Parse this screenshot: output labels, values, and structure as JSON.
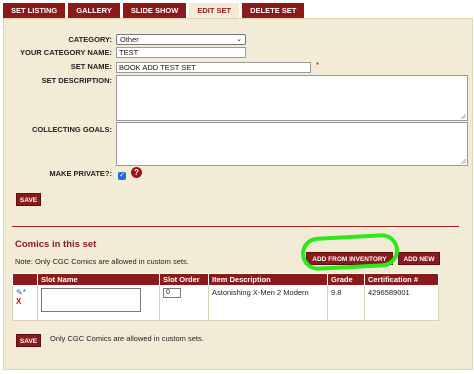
{
  "tabs": [
    {
      "label": "SET LISTING",
      "active": false
    },
    {
      "label": "GALLERY",
      "active": false
    },
    {
      "label": "SLIDE SHOW",
      "active": false
    },
    {
      "label": "EDIT SET",
      "active": true
    },
    {
      "label": "DELETE SET",
      "active": false
    }
  ],
  "form": {
    "category_label": "CATEGORY:",
    "category_value": "Other",
    "your_category_label": "YOUR CATEGORY NAME:",
    "your_category_value": "TEST",
    "set_name_label": "SET NAME:",
    "set_name_value": "BOOK ADD TEST SET",
    "required_mark": "*",
    "set_description_label": "SET DESCRIPTION:",
    "collecting_goals_label": "COLLECTING GOALS:",
    "make_private_label": "MAKE PRIVATE?:",
    "make_private_checked": true,
    "help_glyph": "?",
    "save_label": "SAVE"
  },
  "comics": {
    "title": "Comics in this set",
    "note": "Note: Only CGC Comics are allowed in custom sets.",
    "add_from_inventory_label": "ADD FROM INVENTORY",
    "add_new_label": "ADD NEW",
    "columns": [
      "Slot Name",
      "Slot Order",
      "Item Description",
      "Grade",
      "Certification #"
    ],
    "rows": [
      {
        "slot_order": "0",
        "description": "Astonishing X-Men 2 Modern",
        "grade": "9.8",
        "certification": "4296589001",
        "delete_glyph": "X"
      }
    ],
    "footer_note": "Only CGC Comics are allowed in custom sets.",
    "save_label": "SAVE"
  },
  "colors": {
    "accent": "#8b1a1a",
    "panel": "#f2ecd6",
    "highlight": "#2ee81a"
  }
}
